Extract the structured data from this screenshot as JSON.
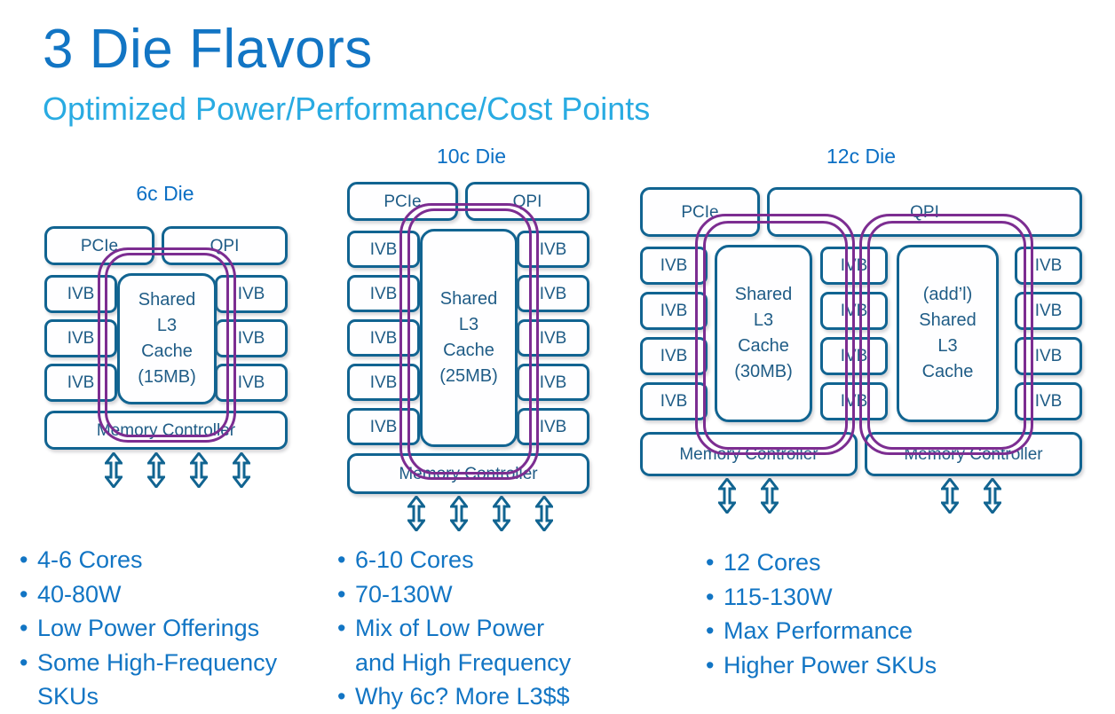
{
  "header": {
    "title": "3 Die Flavors",
    "subtitle": "Optimized Power/Performance/Cost Points",
    "title_color": "#1275c4",
    "subtitle_color": "#29abe2"
  },
  "colors": {
    "box_border": "#116491",
    "box_text": "#1f5c86",
    "ring_purple": "#7c2d91",
    "die_label": "#0b6fc4",
    "bullet_text": "#1275c4",
    "arrow": "#116491"
  },
  "dies": [
    {
      "id": "6c",
      "title": "6c Die",
      "pcie": "PCIe",
      "qpi": "QPI",
      "ivb_label": "IVB",
      "ivb_left_count": 3,
      "ivb_right_count": 3,
      "cache_lines": [
        "Shared",
        "L3",
        "Cache",
        "(15MB)"
      ],
      "memory_controllers": [
        "Memory Controller"
      ],
      "arrow_groups": [
        4
      ],
      "bullets": [
        {
          "text": "4-6 Cores",
          "continuation": false
        },
        {
          "text": "40-80W",
          "continuation": false
        },
        {
          "text": "Low Power Offerings",
          "continuation": false
        },
        {
          "text": "Some High-Frequency",
          "continuation": false
        },
        {
          "text": "SKUs",
          "continuation": true
        }
      ]
    },
    {
      "id": "10c",
      "title": "10c Die",
      "pcie": "PCIe",
      "qpi": "QPI",
      "ivb_label": "IVB",
      "ivb_left_count": 5,
      "ivb_right_count": 5,
      "cache_lines": [
        "Shared",
        "L3",
        "Cache",
        "(25MB)"
      ],
      "memory_controllers": [
        "Memory Controller"
      ],
      "arrow_groups": [
        4
      ],
      "bullets": [
        {
          "text": "6-10 Cores",
          "continuation": false
        },
        {
          "text": "70-130W",
          "continuation": false
        },
        {
          "text": "Mix of Low Power",
          "continuation": false
        },
        {
          "text": "and High Frequency",
          "continuation": true
        },
        {
          "text": "Why 6c? More L3$$",
          "continuation": false
        }
      ]
    },
    {
      "id": "12c",
      "title": "12c Die",
      "pcie": "PCIe",
      "qpi": "QPI",
      "ivb_label": "IVB",
      "ivb_left_count": 4,
      "ivb_mid_count": 4,
      "ivb_right_count": 4,
      "cache_lines": [
        "Shared",
        "L3",
        "Cache",
        "(30MB)"
      ],
      "cache2_lines": [
        "(add’l)",
        "Shared",
        "L3",
        "Cache"
      ],
      "memory_controllers": [
        "Memory Controller",
        "Memory Controller"
      ],
      "arrow_groups": [
        2,
        2
      ],
      "bullets": [
        {
          "text": "12 Cores",
          "continuation": false
        },
        {
          "text": "115-130W",
          "continuation": false
        },
        {
          "text": "Max Performance",
          "continuation": false
        },
        {
          "text": "Higher Power SKUs",
          "continuation": false
        }
      ]
    }
  ]
}
